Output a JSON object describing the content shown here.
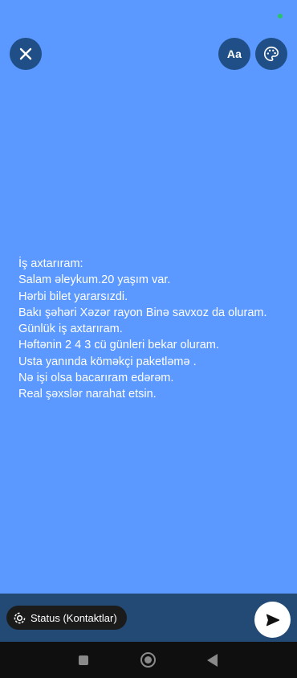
{
  "top_bar": {
    "close_icon": "close-icon",
    "font_button_label": "Aa",
    "palette_icon": "palette-icon"
  },
  "status_text": {
    "lines": [
      "İş axtarıram:",
      "Salam əleykum.20 yaşım var.",
      "Hərbi bilet yararsızdi.",
      "Bakı şəhəri Xəzər rayon Binə savxoz da oluram.",
      "Günlük iş axtarıram.",
      "Həftənin 2 4 3 cü günleri bekar oluram.",
      "Usta yanında köməkçi paketləmə .",
      "Nə işi olsa bacarıram edərəm.",
      "Real şəxslər narahat etsin."
    ]
  },
  "bottom_bar": {
    "audience_label": "Status (Kontaktlar)",
    "audience_icon": "status-icon",
    "send_icon": "send-icon"
  },
  "colors": {
    "background": "#5b98ff",
    "button": "#1f4f86",
    "bottom_bar": "#234a74",
    "online_dot": "#27c46a"
  }
}
